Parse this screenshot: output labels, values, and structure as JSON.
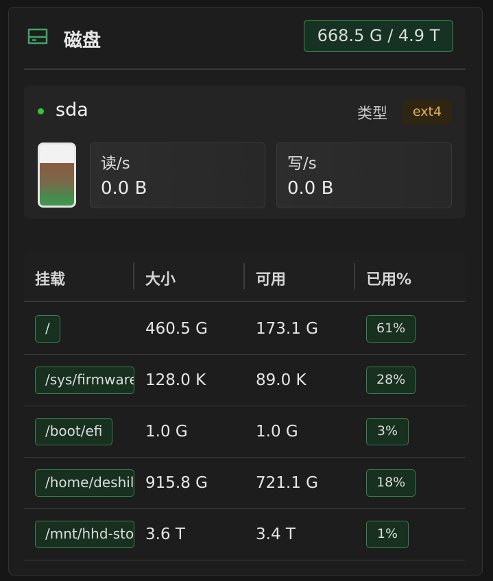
{
  "header": {
    "title": "磁盘",
    "total": "668.5 G / 4.9 T",
    "icon": "hard-drive-icon",
    "accent": "#3e8a57"
  },
  "device": {
    "name": "sda",
    "status_color": "#35c43b",
    "type_label": "类型",
    "type_value": "ext4",
    "usage_fraction": 0.7,
    "read": {
      "label": "读/s",
      "value": "0.0 B"
    },
    "write": {
      "label": "写/s",
      "value": "0.0 B"
    }
  },
  "table": {
    "headers": [
      "挂载",
      "大小",
      "可用",
      "已用%"
    ],
    "rows": [
      {
        "mount": "/",
        "size": "460.5 G",
        "free": "173.1 G",
        "used": "61%"
      },
      {
        "mount": "/sys/firmware",
        "size": "128.0 K",
        "free": "89.0 K",
        "used": "28%"
      },
      {
        "mount": "/boot/efi",
        "size": "1.0 G",
        "free": "1.0 G",
        "used": "3%"
      },
      {
        "mount": "/home/deshil",
        "size": "915.8 G",
        "free": "721.1 G",
        "used": "18%"
      },
      {
        "mount": "/mnt/hhd-sto",
        "size": "3.6 T",
        "free": "3.4 T",
        "used": "1%"
      }
    ]
  }
}
